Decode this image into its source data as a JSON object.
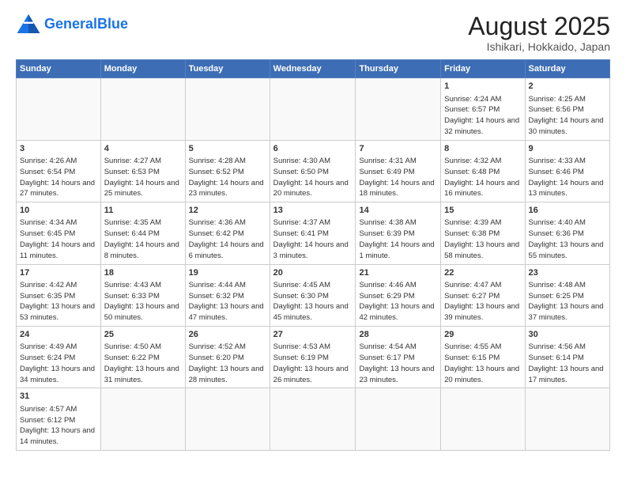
{
  "header": {
    "logo_general": "General",
    "logo_blue": "Blue",
    "title": "August 2025",
    "subtitle": "Ishikari, Hokkaido, Japan"
  },
  "days_of_week": [
    "Sunday",
    "Monday",
    "Tuesday",
    "Wednesday",
    "Thursday",
    "Friday",
    "Saturday"
  ],
  "weeks": [
    [
      {
        "day": "",
        "info": ""
      },
      {
        "day": "",
        "info": ""
      },
      {
        "day": "",
        "info": ""
      },
      {
        "day": "",
        "info": ""
      },
      {
        "day": "",
        "info": ""
      },
      {
        "day": "1",
        "info": "Sunrise: 4:24 AM\nSunset: 6:57 PM\nDaylight: 14 hours and 32 minutes."
      },
      {
        "day": "2",
        "info": "Sunrise: 4:25 AM\nSunset: 6:56 PM\nDaylight: 14 hours and 30 minutes."
      }
    ],
    [
      {
        "day": "3",
        "info": "Sunrise: 4:26 AM\nSunset: 6:54 PM\nDaylight: 14 hours and 27 minutes."
      },
      {
        "day": "4",
        "info": "Sunrise: 4:27 AM\nSunset: 6:53 PM\nDaylight: 14 hours and 25 minutes."
      },
      {
        "day": "5",
        "info": "Sunrise: 4:28 AM\nSunset: 6:52 PM\nDaylight: 14 hours and 23 minutes."
      },
      {
        "day": "6",
        "info": "Sunrise: 4:30 AM\nSunset: 6:50 PM\nDaylight: 14 hours and 20 minutes."
      },
      {
        "day": "7",
        "info": "Sunrise: 4:31 AM\nSunset: 6:49 PM\nDaylight: 14 hours and 18 minutes."
      },
      {
        "day": "8",
        "info": "Sunrise: 4:32 AM\nSunset: 6:48 PM\nDaylight: 14 hours and 16 minutes."
      },
      {
        "day": "9",
        "info": "Sunrise: 4:33 AM\nSunset: 6:46 PM\nDaylight: 14 hours and 13 minutes."
      }
    ],
    [
      {
        "day": "10",
        "info": "Sunrise: 4:34 AM\nSunset: 6:45 PM\nDaylight: 14 hours and 11 minutes."
      },
      {
        "day": "11",
        "info": "Sunrise: 4:35 AM\nSunset: 6:44 PM\nDaylight: 14 hours and 8 minutes."
      },
      {
        "day": "12",
        "info": "Sunrise: 4:36 AM\nSunset: 6:42 PM\nDaylight: 14 hours and 6 minutes."
      },
      {
        "day": "13",
        "info": "Sunrise: 4:37 AM\nSunset: 6:41 PM\nDaylight: 14 hours and 3 minutes."
      },
      {
        "day": "14",
        "info": "Sunrise: 4:38 AM\nSunset: 6:39 PM\nDaylight: 14 hours and 1 minute."
      },
      {
        "day": "15",
        "info": "Sunrise: 4:39 AM\nSunset: 6:38 PM\nDaylight: 13 hours and 58 minutes."
      },
      {
        "day": "16",
        "info": "Sunrise: 4:40 AM\nSunset: 6:36 PM\nDaylight: 13 hours and 55 minutes."
      }
    ],
    [
      {
        "day": "17",
        "info": "Sunrise: 4:42 AM\nSunset: 6:35 PM\nDaylight: 13 hours and 53 minutes."
      },
      {
        "day": "18",
        "info": "Sunrise: 4:43 AM\nSunset: 6:33 PM\nDaylight: 13 hours and 50 minutes."
      },
      {
        "day": "19",
        "info": "Sunrise: 4:44 AM\nSunset: 6:32 PM\nDaylight: 13 hours and 47 minutes."
      },
      {
        "day": "20",
        "info": "Sunrise: 4:45 AM\nSunset: 6:30 PM\nDaylight: 13 hours and 45 minutes."
      },
      {
        "day": "21",
        "info": "Sunrise: 4:46 AM\nSunset: 6:29 PM\nDaylight: 13 hours and 42 minutes."
      },
      {
        "day": "22",
        "info": "Sunrise: 4:47 AM\nSunset: 6:27 PM\nDaylight: 13 hours and 39 minutes."
      },
      {
        "day": "23",
        "info": "Sunrise: 4:48 AM\nSunset: 6:25 PM\nDaylight: 13 hours and 37 minutes."
      }
    ],
    [
      {
        "day": "24",
        "info": "Sunrise: 4:49 AM\nSunset: 6:24 PM\nDaylight: 13 hours and 34 minutes."
      },
      {
        "day": "25",
        "info": "Sunrise: 4:50 AM\nSunset: 6:22 PM\nDaylight: 13 hours and 31 minutes."
      },
      {
        "day": "26",
        "info": "Sunrise: 4:52 AM\nSunset: 6:20 PM\nDaylight: 13 hours and 28 minutes."
      },
      {
        "day": "27",
        "info": "Sunrise: 4:53 AM\nSunset: 6:19 PM\nDaylight: 13 hours and 26 minutes."
      },
      {
        "day": "28",
        "info": "Sunrise: 4:54 AM\nSunset: 6:17 PM\nDaylight: 13 hours and 23 minutes."
      },
      {
        "day": "29",
        "info": "Sunrise: 4:55 AM\nSunset: 6:15 PM\nDaylight: 13 hours and 20 minutes."
      },
      {
        "day": "30",
        "info": "Sunrise: 4:56 AM\nSunset: 6:14 PM\nDaylight: 13 hours and 17 minutes."
      }
    ],
    [
      {
        "day": "31",
        "info": "Sunrise: 4:57 AM\nSunset: 6:12 PM\nDaylight: 13 hours and 14 minutes."
      },
      {
        "day": "",
        "info": ""
      },
      {
        "day": "",
        "info": ""
      },
      {
        "day": "",
        "info": ""
      },
      {
        "day": "",
        "info": ""
      },
      {
        "day": "",
        "info": ""
      },
      {
        "day": "",
        "info": ""
      }
    ]
  ]
}
